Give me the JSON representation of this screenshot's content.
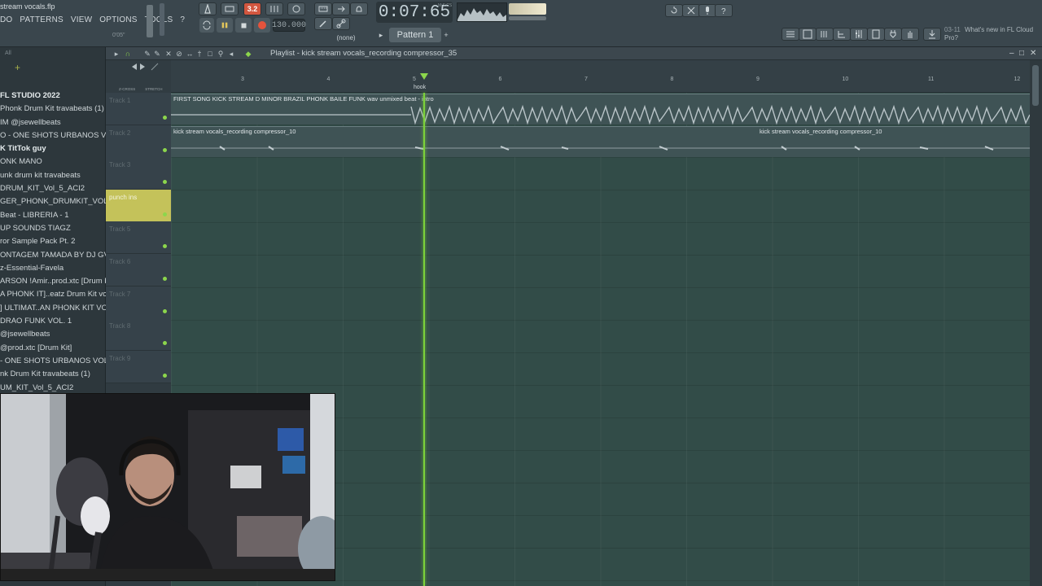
{
  "app": {
    "file_title": "stream vocals.flp",
    "menu": [
      "DO",
      "PATTERNS",
      "VIEW",
      "OPTIONS",
      "TOOLS",
      "?"
    ],
    "cpu_mini": "0'05\""
  },
  "transport": {
    "time": "0:07:65",
    "time_unit": "M:S:CS",
    "bpm": "130.000",
    "step_indicator": "3.2",
    "snap": "(none)",
    "pattern": "Pattern 1"
  },
  "news": {
    "date": "03-11",
    "text": "What's new in FL Cloud Pro?"
  },
  "playlist": {
    "title": "Playlist - kick stream vocals_recording compressor_35",
    "ruler_tags": [
      "Z-CROSS",
      "STRETCH"
    ],
    "bars": [
      "3",
      "4",
      "5",
      "6",
      "7",
      "8",
      "9",
      "10",
      "11",
      "12"
    ],
    "marker": "hook",
    "tracks": [
      {
        "name": "Track 1",
        "highlight": false
      },
      {
        "name": "Track 2",
        "highlight": false
      },
      {
        "name": "Track 3",
        "highlight": false
      },
      {
        "name": "punch ins",
        "highlight": true
      },
      {
        "name": "Track 5",
        "highlight": false
      },
      {
        "name": "Track 6",
        "highlight": false
      },
      {
        "name": "Track 7",
        "highlight": false
      },
      {
        "name": "Track 8",
        "highlight": false
      },
      {
        "name": "Track 9",
        "highlight": false
      }
    ],
    "clips": [
      {
        "label": "FIRST SONG KICK STREAM D MINOR BRAZIL PHONK BAILE FUNK wav unmixed beat - intro"
      },
      {
        "label": "kick stream vocals_recording compressor_10"
      },
      {
        "label": "kick stream vocals_recording compressor_10"
      }
    ]
  },
  "browser": {
    "filter": "All",
    "items": [
      {
        "label": "FL STUDIO 2022",
        "bold": true
      },
      {
        "label": "Phonk Drum Kit travabeats (1)",
        "bold": false
      },
      {
        "label": "IM @jsewellbeats",
        "bold": false
      },
      {
        "label": "O - ONE SHOTS URBANOS VOL. 2",
        "bold": false
      },
      {
        "label": "K TitTok guy",
        "bold": true
      },
      {
        "label": "ONK MANO",
        "bold": false
      },
      {
        "label": "unk drum kit travabeats",
        "bold": false
      },
      {
        "label": "DRUM_KIT_Vol_5_ACI2",
        "bold": false
      },
      {
        "label": "GER_PHONK_DRUMKIT_VOL_3",
        "bold": false
      },
      {
        "label": "Beat - LIBRERIA - 1",
        "bold": false
      },
      {
        "label": "UP SOUNDS TIAGZ",
        "bold": false
      },
      {
        "label": "ror Sample Pack Pt. 2",
        "bold": false
      },
      {
        "label": "ONTAGEM TAMADA BY DJ GVX",
        "bold": false
      },
      {
        "label": "z-Essential-Favela",
        "bold": false
      },
      {
        "label": "ARSON !Amir..prod.xtc [Drum Kit]",
        "bold": false
      },
      {
        "label": "A PHONK IT]..eatz Drum Kit vol 1",
        "bold": false
      },
      {
        "label": "] ULTIMAT..AN PHONK KIT VOL. 3",
        "bold": false
      },
      {
        "label": "DRAO FUNK VOL. 1",
        "bold": false
      },
      {
        "label": "@jsewellbeats",
        "bold": false
      },
      {
        "label": "@prod.xtc [Drum Kit]",
        "bold": false
      },
      {
        "label": "- ONE SHOTS URBANOS VOL. 2",
        "bold": false
      },
      {
        "label": "nk Drum Kit travabeats (1)",
        "bold": false
      },
      {
        "label": "UM_KIT_Vol_5_ACI2",
        "bold": false
      }
    ]
  },
  "colors": {
    "playhead": "#7cd23a",
    "record": "#e5533c",
    "highlight_track": "#c4c25a"
  }
}
